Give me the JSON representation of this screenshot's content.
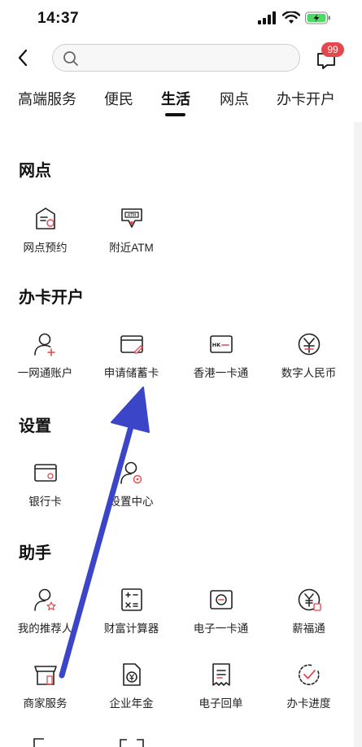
{
  "status_bar": {
    "time": "14:37"
  },
  "nav": {
    "search_placeholder": "",
    "badge_count": "99"
  },
  "tabs": [
    {
      "label": "高端服务"
    },
    {
      "label": "便民"
    },
    {
      "label": "生活"
    },
    {
      "label": "网点"
    },
    {
      "label": "办卡开户"
    }
  ],
  "active_tab": "生活",
  "sections": {
    "branch": {
      "title": "网点",
      "items": [
        {
          "label": "网点预约",
          "icon": "calendar-doc-icon"
        },
        {
          "label": "附近ATM",
          "icon": "atm-icon"
        }
      ]
    },
    "account": {
      "title": "办卡开户",
      "items": [
        {
          "label": "一网通账户",
          "icon": "user-plus-icon"
        },
        {
          "label": "申请储蓄卡",
          "icon": "card-edit-icon"
        },
        {
          "label": "香港一卡通",
          "icon": "hk-card-icon"
        },
        {
          "label": "数字人民币",
          "icon": "digital-rmb-icon"
        }
      ]
    },
    "settings": {
      "title": "设置",
      "items": [
        {
          "label": "银行卡",
          "icon": "bank-card-icon"
        },
        {
          "label": "设置中心",
          "icon": "user-settings-icon"
        }
      ]
    },
    "assistant": {
      "title": "助手",
      "items": [
        {
          "label": "我的推荐人",
          "icon": "user-star-icon"
        },
        {
          "label": "财富计算器",
          "icon": "calculator-icon"
        },
        {
          "label": "电子一卡通",
          "icon": "e-card-icon"
        },
        {
          "label": "薪福通",
          "icon": "salary-coin-icon"
        },
        {
          "label": "商家服务",
          "icon": "shop-icon"
        },
        {
          "label": "企业年金",
          "icon": "pension-icon"
        },
        {
          "label": "电子回单",
          "icon": "receipt-icon"
        },
        {
          "label": "办卡进度",
          "icon": "progress-check-icon"
        }
      ]
    }
  },
  "colors": {
    "accent": "#e4474d",
    "arrow": "#3a45c8",
    "text": "#111111"
  }
}
